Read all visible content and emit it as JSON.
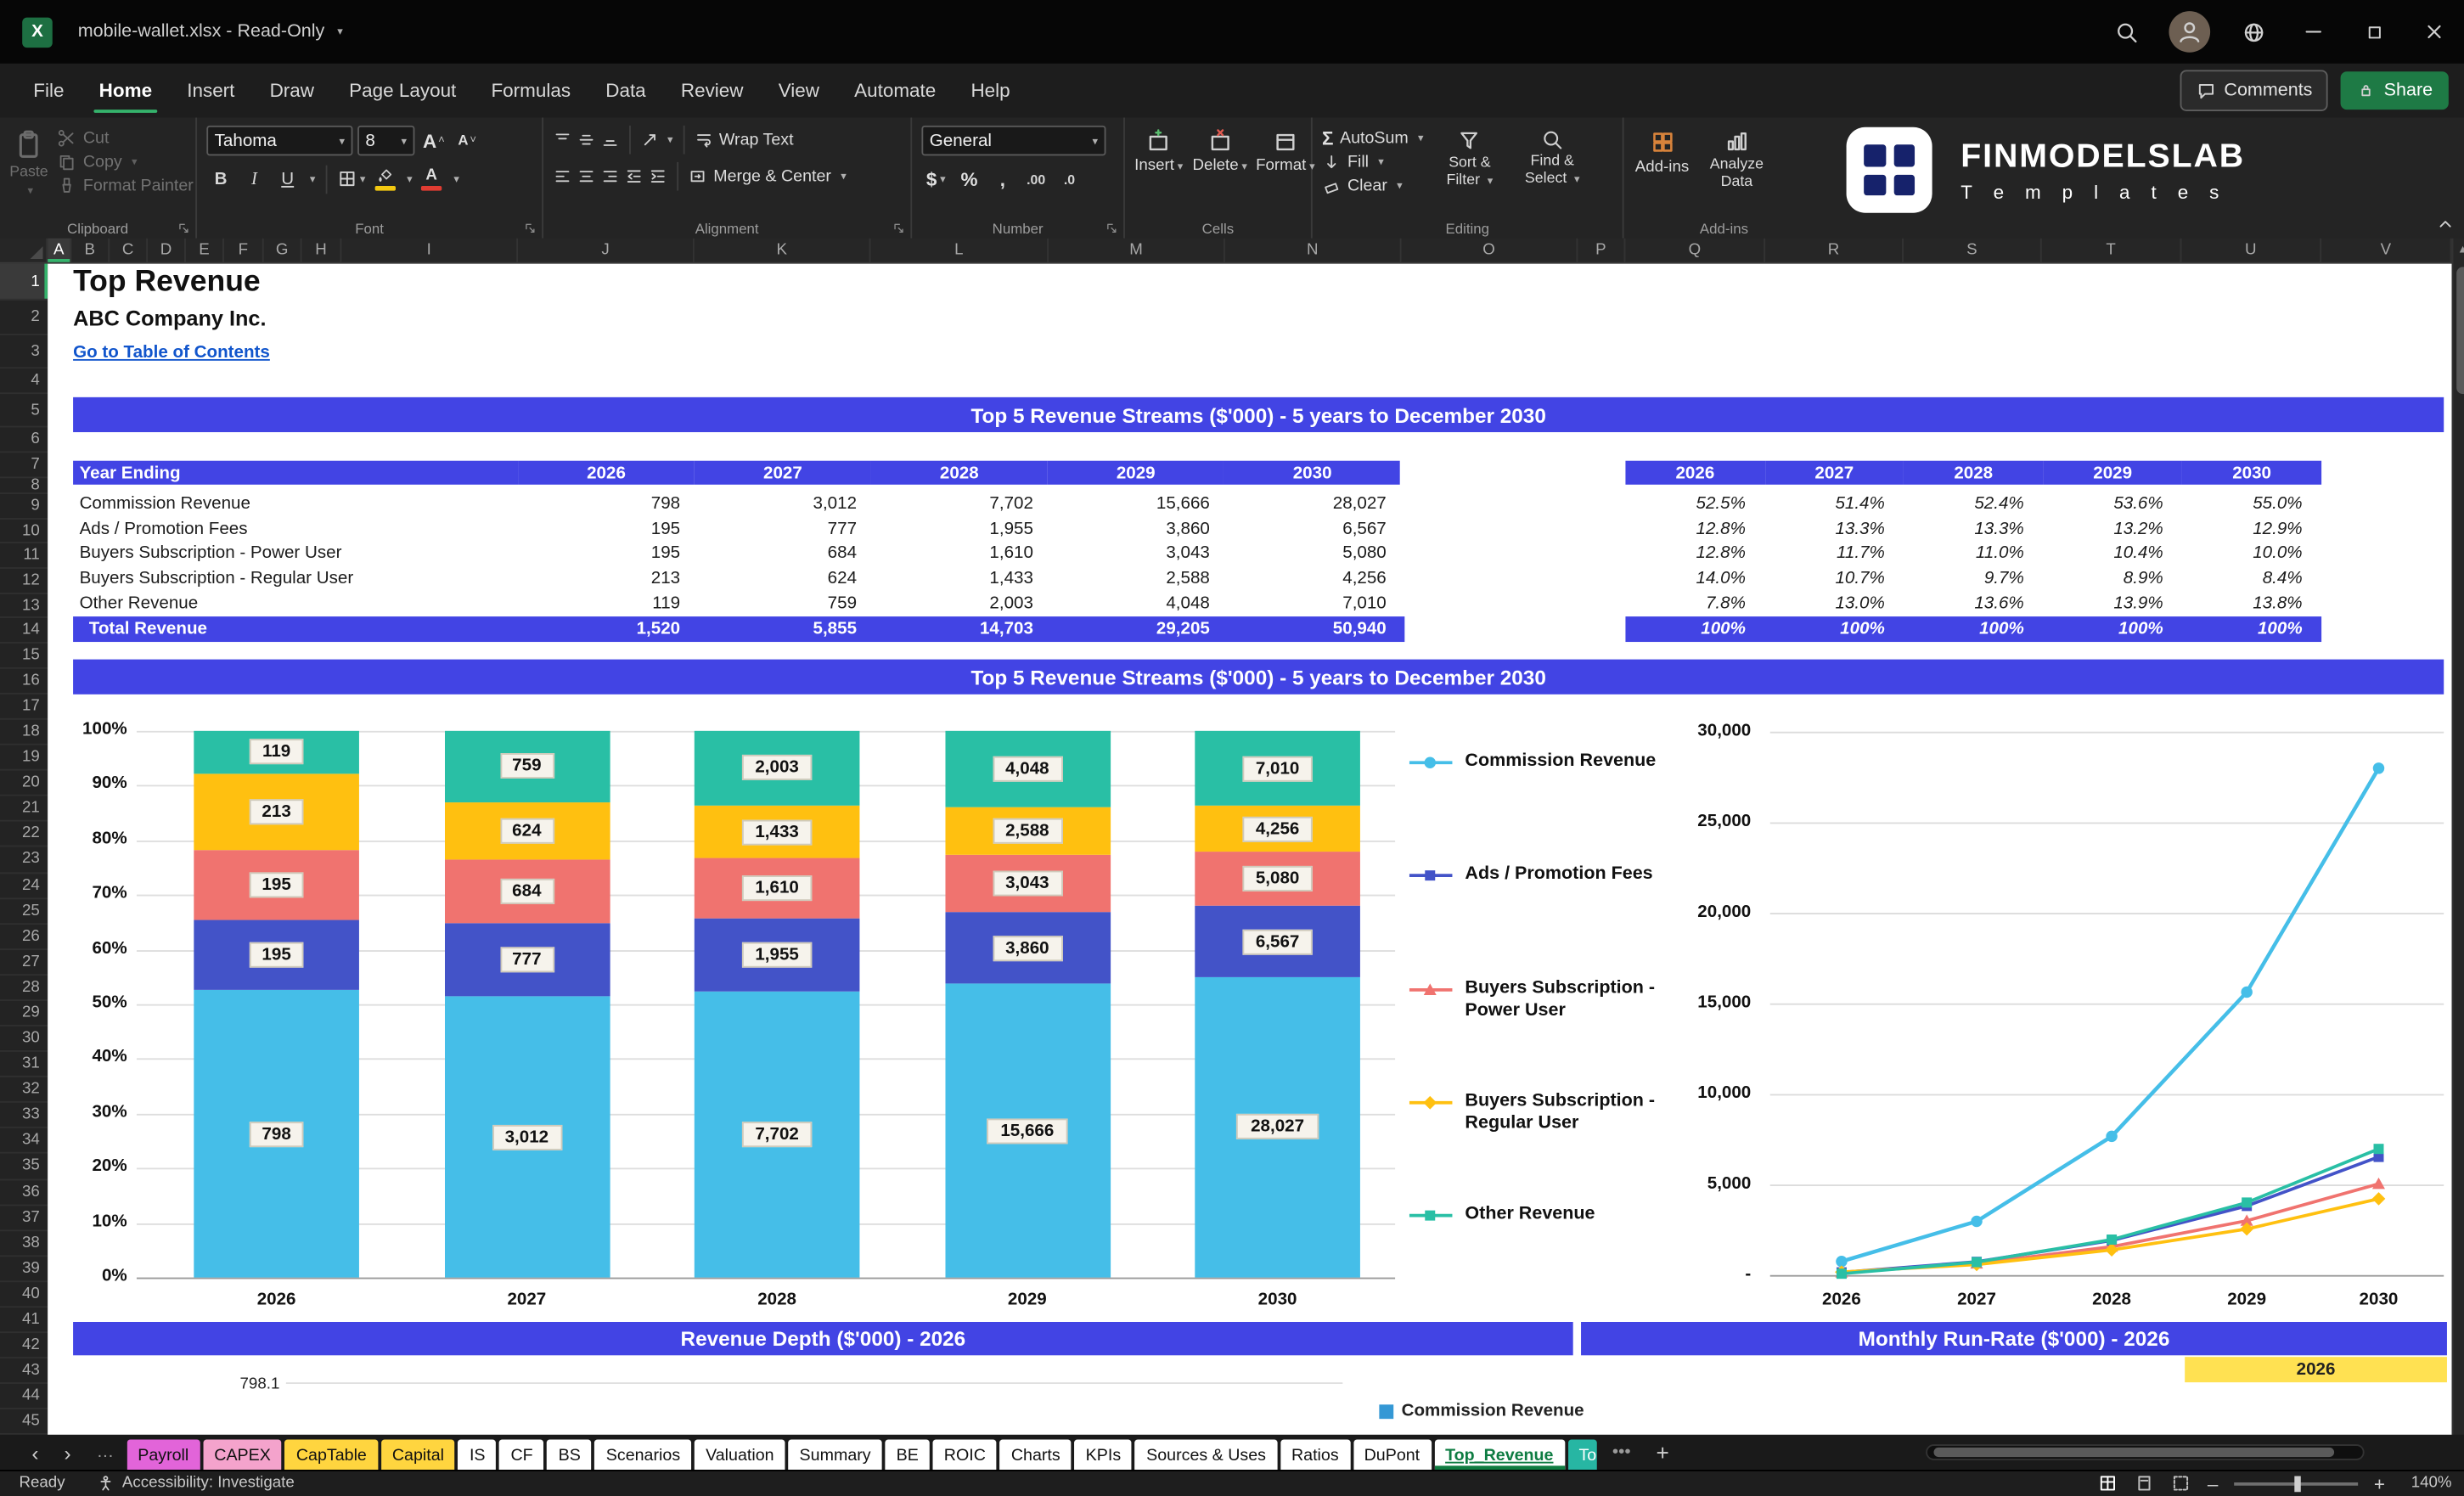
{
  "titlebar": {
    "app": "Excel",
    "title": "mobile-wallet.xlsx  -  Read-Only"
  },
  "menubar": {
    "tabs": [
      "File",
      "Home",
      "Insert",
      "Draw",
      "Page Layout",
      "Formulas",
      "Data",
      "Review",
      "View",
      "Automate",
      "Help"
    ],
    "active_tab": "Home",
    "comments_label": "Comments",
    "share_label": "Share"
  },
  "ribbon": {
    "groups": {
      "clipboard": {
        "label": "Clipboard",
        "paste": "Paste",
        "cut": "Cut",
        "copy": "Copy",
        "format_painter": "Format Painter"
      },
      "font": {
        "label": "Font",
        "font_name": "Tahoma",
        "font_size": "8"
      },
      "alignment": {
        "label": "Alignment",
        "wrap_text": "Wrap Text",
        "merge_center": "Merge & Center"
      },
      "number": {
        "label": "Number",
        "format": "General"
      },
      "cells": {
        "label": "Cells",
        "insert": "Insert",
        "delete": "Delete",
        "format": "Format"
      },
      "editing": {
        "label": "Editing",
        "autosum": "AutoSum",
        "fill": "Fill",
        "clear": "Clear",
        "sort_filter": "Sort & Filter",
        "find_select": "Find & Select"
      },
      "addins": {
        "label": "Add-ins",
        "addins_button": "Add-ins",
        "analyze_button": "Analyze Data"
      }
    },
    "brand": {
      "name": "FINMODELSLAB",
      "subtitle": "T e m p l a t e s"
    }
  },
  "grid": {
    "columns": [
      "A",
      "B",
      "C",
      "D",
      "E",
      "F",
      "G",
      "H",
      "I",
      "J",
      "K",
      "L",
      "M",
      "N",
      "O",
      "P",
      "Q",
      "R",
      "S",
      "T",
      "U",
      "V"
    ],
    "row_count": 45,
    "selected_column": "A",
    "selected_row": 1
  },
  "sheet": {
    "title": "Top Revenue",
    "company": "ABC Company Inc.",
    "toc_link": "Go to Table of Contents",
    "banner_top": "Top 5 Revenue Streams ($'000) - 5 years to December 2030",
    "banner_chart": "Top 5 Revenue Streams ($'000) - 5 years to December 2030",
    "banner_depth": "Revenue Depth ($'000) - 2026",
    "banner_runrate": "Monthly Run-Rate ($'000) - 2026",
    "runrate_year_cell": "2026",
    "depth_axis_value": "798.1",
    "depth_legend": "Commission Revenue",
    "depth_legend_color": "#3498D5",
    "table": {
      "row_header": "Year Ending",
      "years": [
        "2026",
        "2027",
        "2028",
        "2029",
        "2030"
      ],
      "rows": [
        {
          "label": "Commission Revenue",
          "values": [
            "798",
            "3,012",
            "7,702",
            "15,666",
            "28,027"
          ],
          "pcts": [
            "52.5%",
            "51.4%",
            "52.4%",
            "53.6%",
            "55.0%"
          ]
        },
        {
          "label": "Ads / Promotion Fees",
          "values": [
            "195",
            "777",
            "1,955",
            "3,860",
            "6,567"
          ],
          "pcts": [
            "12.8%",
            "13.3%",
            "13.3%",
            "13.2%",
            "12.9%"
          ]
        },
        {
          "label": "Buyers Subscription - Power User",
          "values": [
            "195",
            "684",
            "1,610",
            "3,043",
            "5,080"
          ],
          "pcts": [
            "12.8%",
            "11.7%",
            "11.0%",
            "10.4%",
            "10.0%"
          ]
        },
        {
          "label": "Buyers Subscription - Regular User",
          "values": [
            "213",
            "624",
            "1,433",
            "2,588",
            "4,256"
          ],
          "pcts": [
            "14.0%",
            "10.7%",
            "9.7%",
            "8.9%",
            "8.4%"
          ]
        },
        {
          "label": "Other Revenue",
          "values": [
            "119",
            "759",
            "2,003",
            "4,048",
            "7,010"
          ],
          "pcts": [
            "7.8%",
            "13.0%",
            "13.6%",
            "13.9%",
            "13.8%"
          ]
        }
      ],
      "total": {
        "label": "Total Revenue",
        "values": [
          "1,520",
          "5,855",
          "14,703",
          "29,205",
          "50,940"
        ],
        "pcts": [
          "100%",
          "100%",
          "100%",
          "100%",
          "100%"
        ]
      }
    }
  },
  "chart_data": [
    {
      "type": "bar",
      "subtype": "stacked-100pct",
      "title": "Top 5 Revenue Streams ($'000) - 5 years to December 2030",
      "categories": [
        "2026",
        "2027",
        "2028",
        "2029",
        "2030"
      ],
      "series": [
        {
          "name": "Commission Revenue",
          "color": "#45BEE8",
          "marker": "circle",
          "values": [
            798,
            3012,
            7702,
            15666,
            28027
          ],
          "labels": [
            "798",
            "3,012",
            "7,702",
            "15,666",
            "28,027"
          ]
        },
        {
          "name": "Ads / Promotion Fees",
          "color": "#4353C8",
          "marker": "square",
          "values": [
            195,
            777,
            1955,
            3860,
            6567
          ],
          "labels": [
            "195",
            "777",
            "1,955",
            "3,860",
            "6,567"
          ]
        },
        {
          "name": "Buyers Subscription - Power User",
          "color": "#F0736F",
          "marker": "triangle",
          "values": [
            195,
            684,
            1610,
            3043,
            5080
          ],
          "labels": [
            "195",
            "684",
            "1,610",
            "3,043",
            "5,080"
          ]
        },
        {
          "name": "Buyers Subscription - Regular User",
          "color": "#FFC010",
          "marker": "diamond",
          "values": [
            213,
            624,
            1433,
            2588,
            4256
          ],
          "labels": [
            "213",
            "624",
            "1,433",
            "2,588",
            "4,256"
          ]
        },
        {
          "name": "Other Revenue",
          "color": "#29BFA5",
          "marker": "square",
          "values": [
            119,
            759,
            2003,
            4048,
            7010
          ],
          "labels": [
            "119",
            "759",
            "2,003",
            "4,048",
            "7,010"
          ]
        }
      ],
      "y_ticks": [
        "100%",
        "90%",
        "80%",
        "70%",
        "60%",
        "50%",
        "40%",
        "30%",
        "20%",
        "10%",
        "0%"
      ],
      "ylim": [
        0,
        1
      ],
      "grid": true,
      "legend_position": "right"
    },
    {
      "type": "line",
      "categories": [
        "2026",
        "2027",
        "2028",
        "2029",
        "2030"
      ],
      "series": [
        {
          "name": "Commission Revenue",
          "color": "#45BEE8",
          "marker": "circle",
          "values": [
            798,
            3012,
            7702,
            15666,
            28027
          ]
        },
        {
          "name": "Ads / Promotion Fees",
          "color": "#4353C8",
          "marker": "square",
          "values": [
            195,
            777,
            1955,
            3860,
            6567
          ]
        },
        {
          "name": "Buyers Subscription - Power User",
          "color": "#F0736F",
          "marker": "triangle",
          "values": [
            195,
            684,
            1610,
            3043,
            5080
          ]
        },
        {
          "name": "Buyers Subscription - Regular User",
          "color": "#FFC010",
          "marker": "diamond",
          "values": [
            213,
            624,
            1433,
            2588,
            4256
          ]
        },
        {
          "name": "Other Revenue",
          "color": "#29BFA5",
          "marker": "square",
          "values": [
            119,
            759,
            2003,
            4048,
            7010
          ]
        }
      ],
      "y_ticks": [
        "30,000",
        "25,000",
        "20,000",
        "15,000",
        "10,000",
        "5,000",
        "-"
      ],
      "ylim": [
        0,
        30000
      ],
      "grid": true
    }
  ],
  "tabs": {
    "items": [
      {
        "label": "Payroll",
        "color": "#E264D9",
        "text": "#111111"
      },
      {
        "label": "CAPEX",
        "color": "#F4A3CC",
        "text": "#111111"
      },
      {
        "label": "CapTable",
        "color": "#FFD53F",
        "text": "#111111"
      },
      {
        "label": "Capital",
        "color": "#FFD53F",
        "text": "#111111"
      },
      {
        "label": "IS",
        "color": "#FFFFFF",
        "text": "#111111"
      },
      {
        "label": "CF",
        "color": "#FFFFFF",
        "text": "#111111"
      },
      {
        "label": "BS",
        "color": "#FFFFFF",
        "text": "#111111"
      },
      {
        "label": "Scenarios",
        "color": "#FFFFFF",
        "text": "#111111"
      },
      {
        "label": "Valuation",
        "color": "#FFFFFF",
        "text": "#111111"
      },
      {
        "label": "Summary",
        "color": "#FFFFFF",
        "text": "#111111"
      },
      {
        "label": "BE",
        "color": "#FFFFFF",
        "text": "#111111"
      },
      {
        "label": "ROIC",
        "color": "#FFFFFF",
        "text": "#111111"
      },
      {
        "label": "Charts",
        "color": "#FFFFFF",
        "text": "#111111"
      },
      {
        "label": "KPIs",
        "color": "#FFFFFF",
        "text": "#111111"
      },
      {
        "label": "Sources & Uses",
        "color": "#FFFFFF",
        "text": "#111111"
      },
      {
        "label": "Ratios",
        "color": "#FFFFFF",
        "text": "#111111"
      },
      {
        "label": "DuPont",
        "color": "#FFFFFF",
        "text": "#111111"
      },
      {
        "label": "Top_Revenue",
        "color": "#FFFFFF",
        "text": "#0E7C42",
        "active": true
      },
      {
        "label": "To",
        "color": "#27B6A3",
        "text": "#FFFFFF",
        "truncated": true
      }
    ]
  },
  "statusbar": {
    "ready": "Ready",
    "accessibility": "Accessibility: Investigate",
    "zoom": "140%"
  },
  "colors": {
    "banner_blue": "#4244E4",
    "link_blue": "#1155CC",
    "yellow_cell": "#FFE152",
    "share_green": "#1E7A45"
  }
}
